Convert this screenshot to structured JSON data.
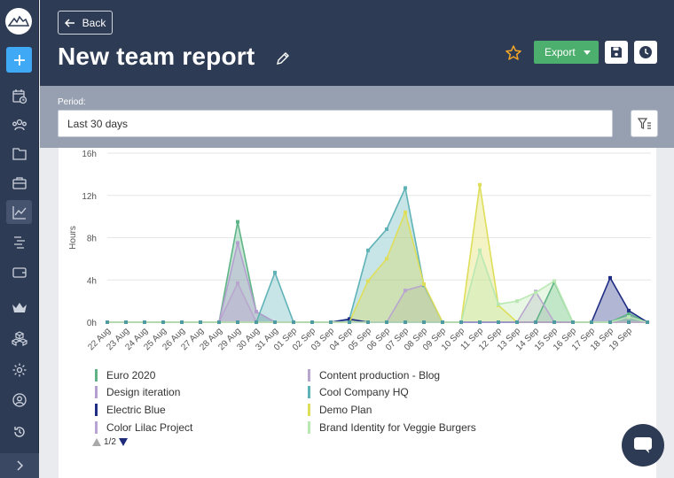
{
  "header": {
    "back_label": "Back",
    "title": "New team report",
    "export_label": "Export"
  },
  "period": {
    "label": "Period:",
    "value": "Last 30 days"
  },
  "chart_data": {
    "type": "area",
    "ylabel": "Hours",
    "xlabel": "",
    "ylim": [
      0,
      16
    ],
    "yticks": [
      "0h",
      "4h",
      "8h",
      "12h",
      "16h"
    ],
    "categories": [
      "22 Aug",
      "23 Aug",
      "24 Aug",
      "25 Aug",
      "26 Aug",
      "27 Aug",
      "28 Aug",
      "29 Aug",
      "30 Aug",
      "31 Aug",
      "01 Sep",
      "02 Sep",
      "03 Sep",
      "04 Sep",
      "05 Sep",
      "06 Sep",
      "07 Sep",
      "08 Sep",
      "09 Sep",
      "10 Sep",
      "11 Sep",
      "12 Sep",
      "13 Sep",
      "14 Sep",
      "15 Sep",
      "16 Sep",
      "17 Sep",
      "18 Sep",
      "19 Sep",
      ""
    ],
    "series": [
      {
        "name": "Euro 2020",
        "color": "#5fb487",
        "values": [
          0,
          0,
          0,
          0,
          0,
          0,
          0,
          9.5,
          1,
          0,
          0,
          0,
          0,
          0,
          0,
          0,
          0,
          0,
          0,
          0,
          0,
          0,
          0,
          0,
          3.8,
          0,
          0,
          0,
          0.8,
          0
        ]
      },
      {
        "name": "Content production - Blog",
        "color": "#b9a6cf",
        "values": [
          0,
          0,
          0,
          0,
          0,
          0,
          0,
          3.7,
          0,
          0,
          0,
          0,
          0,
          0,
          0,
          0,
          3,
          3.5,
          0,
          0,
          0,
          0,
          0,
          2.9,
          0,
          0,
          0,
          0,
          0,
          0
        ]
      },
      {
        "name": "Design iteration",
        "color": "#b59fd0",
        "values": [
          0,
          0,
          0,
          0,
          0,
          0,
          0,
          7.5,
          1,
          0,
          0,
          0,
          0,
          0,
          0,
          0,
          0,
          0,
          0,
          0,
          0,
          0,
          0,
          0,
          0,
          0,
          0,
          0,
          0,
          0
        ]
      },
      {
        "name": "Cool Company HQ",
        "color": "#5fb3b7",
        "values": [
          0,
          0,
          0,
          0,
          0,
          0,
          0,
          0,
          0,
          4.7,
          0,
          0,
          0,
          0.3,
          6.8,
          8.8,
          12.7,
          3.5,
          0,
          0,
          0,
          0,
          0,
          0,
          0,
          0,
          0,
          0,
          0,
          0
        ]
      },
      {
        "name": "Electric Blue",
        "color": "#1f2d84",
        "values": [
          0,
          0,
          0,
          0,
          0,
          0,
          0,
          0,
          0,
          0,
          0,
          0,
          0,
          0.3,
          0,
          0,
          0,
          0,
          0,
          0,
          0,
          0,
          0,
          0,
          0,
          0,
          0,
          4.2,
          1.1,
          0
        ]
      },
      {
        "name": "Demo Plan",
        "color": "#dede5a",
        "values": [
          0,
          0,
          0,
          0,
          0,
          0,
          0,
          0,
          0,
          0,
          0,
          0,
          0,
          0,
          3.9,
          6,
          10.4,
          3.6,
          0,
          0,
          13,
          1.6,
          0,
          0,
          0,
          0,
          0,
          0,
          0,
          0
        ]
      },
      {
        "name": "Color Lilac Project",
        "color": "#b8a5d4",
        "values": [
          0,
          0,
          0,
          0,
          0,
          0,
          0,
          0,
          0,
          0,
          0,
          0,
          0,
          0,
          0,
          0,
          0,
          0,
          0,
          0,
          0,
          0,
          0,
          0,
          0,
          0,
          0,
          0,
          0,
          0
        ]
      },
      {
        "name": "Brand Identity for Veggie Burgers",
        "color": "#b9e8b3",
        "values": [
          0,
          0,
          0,
          0,
          0,
          0,
          0,
          0,
          0,
          0,
          0,
          0,
          0,
          0,
          0,
          0,
          0,
          0,
          0,
          0,
          6.8,
          1.7,
          2,
          2.8,
          3.9,
          0,
          0,
          0,
          0.5,
          0
        ]
      }
    ],
    "legend_page": "1/2",
    "legend_position": "bottom"
  },
  "legend": {
    "items": [
      {
        "name": "Euro 2020",
        "color": "#5fb487"
      },
      {
        "name": "Content production - Blog",
        "color": "#b9a6cf"
      },
      {
        "name": "Design iteration",
        "color": "#b59fd0"
      },
      {
        "name": "Cool Company HQ",
        "color": "#5fb3b7"
      },
      {
        "name": "Electric Blue",
        "color": "#1f2d84"
      },
      {
        "name": "Demo Plan",
        "color": "#dede5a"
      },
      {
        "name": "Color Lilac Project",
        "color": "#b8a5d4"
      },
      {
        "name": "Brand Identity for Veggie Burgers",
        "color": "#b9e8b3"
      }
    ],
    "page": "1/2"
  },
  "sidebar": {
    "icons": [
      "logo-icon",
      "add-icon",
      "timesheet-icon",
      "team-icon",
      "projects-icon",
      "clients-icon",
      "reports-icon",
      "planning-icon",
      "billing-icon",
      "premium-icon",
      "integrations-icon",
      "settings-icon",
      "profile-icon",
      "history-icon",
      "expand-icon"
    ]
  }
}
